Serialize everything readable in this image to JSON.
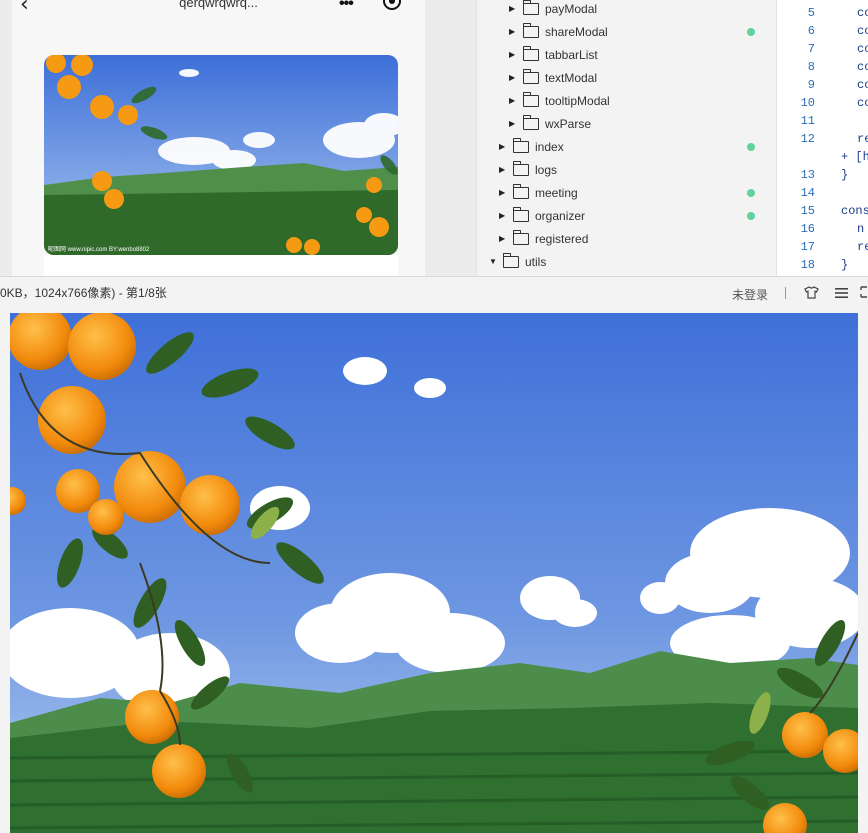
{
  "simulator": {
    "title": "qerqwrqwrq...",
    "back_icon": "chevron-left-icon",
    "menu_icon": "more-dots-icon",
    "capsule_icon": "record-icon"
  },
  "file_tree": {
    "items": [
      {
        "label": "payModal",
        "modified": false
      },
      {
        "label": "shareModal",
        "modified": true
      },
      {
        "label": "tabbarList",
        "modified": false
      },
      {
        "label": "textModal",
        "modified": false
      },
      {
        "label": "tooltipModal",
        "modified": false
      },
      {
        "label": "wxParse",
        "modified": false
      },
      {
        "label": "index",
        "modified": true
      },
      {
        "label": "logs",
        "modified": false
      },
      {
        "label": "meeting",
        "modified": true
      },
      {
        "label": "organizer",
        "modified": true
      },
      {
        "label": "registered",
        "modified": false
      },
      {
        "label": "utils",
        "modified": false
      }
    ]
  },
  "editor": {
    "line_numbers": [
      "5",
      "6",
      "7",
      "8",
      "9",
      "10",
      "11",
      "12",
      "13",
      "14",
      "15",
      "16",
      "17",
      "18"
    ],
    "lines": [
      "co",
      "co",
      "co",
      "co",
      "co",
      "co",
      "",
      "re",
      "+ [h",
      "}",
      "",
      "cons",
      "n",
      "re",
      "}"
    ]
  },
  "viewer": {
    "info": "0KB，1024x766像素) - 第1/8张",
    "login": "未登录",
    "shirt_icon": "skin-icon",
    "menu_icon": "hamburger-icon",
    "expand_icon": "expand-icon"
  },
  "image": {
    "watermark": "昵图网 www.nipic.com BY:wenbo8802"
  },
  "colors": {
    "modified_dot": "#5fd39b",
    "line_number": "#2b6fb6",
    "code_text": "#1d3c8c"
  }
}
